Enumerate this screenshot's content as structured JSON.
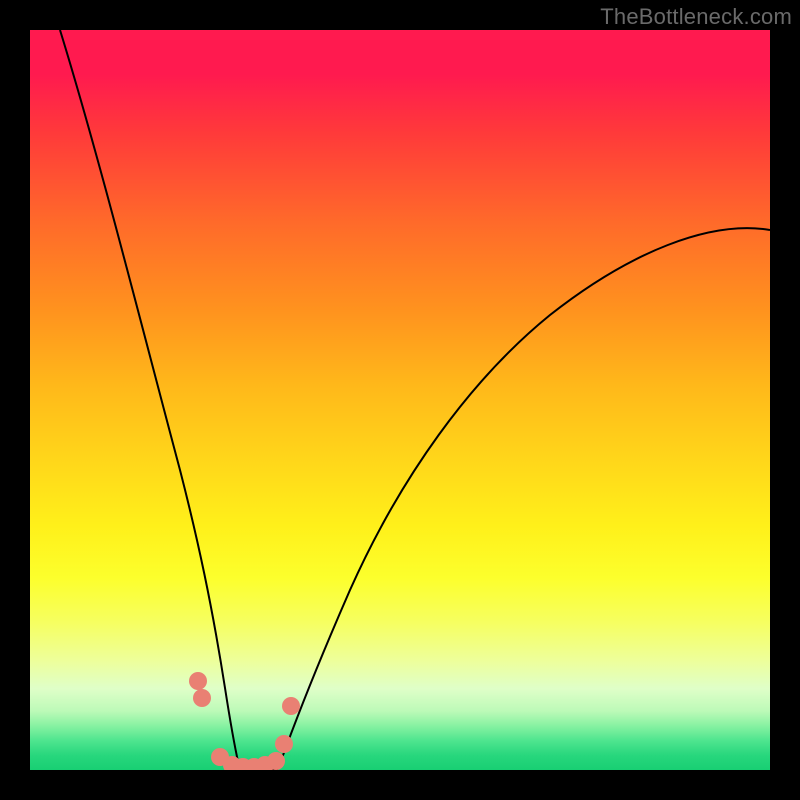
{
  "watermark": "TheBottleneck.com",
  "chart_data": {
    "type": "line",
    "title": "",
    "xlabel": "",
    "ylabel": "",
    "xlim": [
      0,
      100
    ],
    "ylim": [
      0,
      100
    ],
    "legend": false,
    "grid": false,
    "background_gradient": [
      {
        "stop": 0.0,
        "color": "#ff1a4f"
      },
      {
        "stop": 0.42,
        "color": "#ff931e"
      },
      {
        "stop": 0.7,
        "color": "#fff01a"
      },
      {
        "stop": 0.9,
        "color": "#dfffc8"
      },
      {
        "stop": 1.0,
        "color": "#18cf73"
      }
    ],
    "series": [
      {
        "name": "left-branch",
        "color": "#000000",
        "x": [
          4,
          6,
          8,
          10,
          12,
          14,
          16,
          18,
          20,
          22,
          24,
          25,
          26,
          27
        ],
        "y": [
          100,
          90,
          80,
          70,
          60,
          52,
          44,
          36,
          28,
          20,
          12,
          7,
          3,
          0
        ]
      },
      {
        "name": "right-branch",
        "color": "#000000",
        "x": [
          33,
          35,
          38,
          42,
          46,
          52,
          58,
          65,
          72,
          80,
          88,
          96,
          100
        ],
        "y": [
          0,
          3,
          8,
          15,
          22,
          30,
          38,
          46,
          53,
          60,
          66,
          71,
          73
        ]
      },
      {
        "name": "valley-floor",
        "color": "#000000",
        "x": [
          27,
          28,
          29,
          30,
          31,
          32,
          33
        ],
        "y": [
          0,
          0,
          0,
          0,
          0,
          0,
          0
        ]
      }
    ],
    "markers": {
      "name": "highlight-dots",
      "color": "#e98073",
      "radius_px": 9,
      "points_xy": [
        [
          22.5,
          12
        ],
        [
          23.0,
          10
        ],
        [
          25.5,
          1.5
        ],
        [
          27.0,
          0.5
        ],
        [
          28.5,
          0.3
        ],
        [
          30.0,
          0.3
        ],
        [
          31.5,
          0.5
        ],
        [
          33.0,
          1.2
        ],
        [
          34.0,
          3.5
        ],
        [
          35.0,
          8.5
        ]
      ]
    }
  }
}
